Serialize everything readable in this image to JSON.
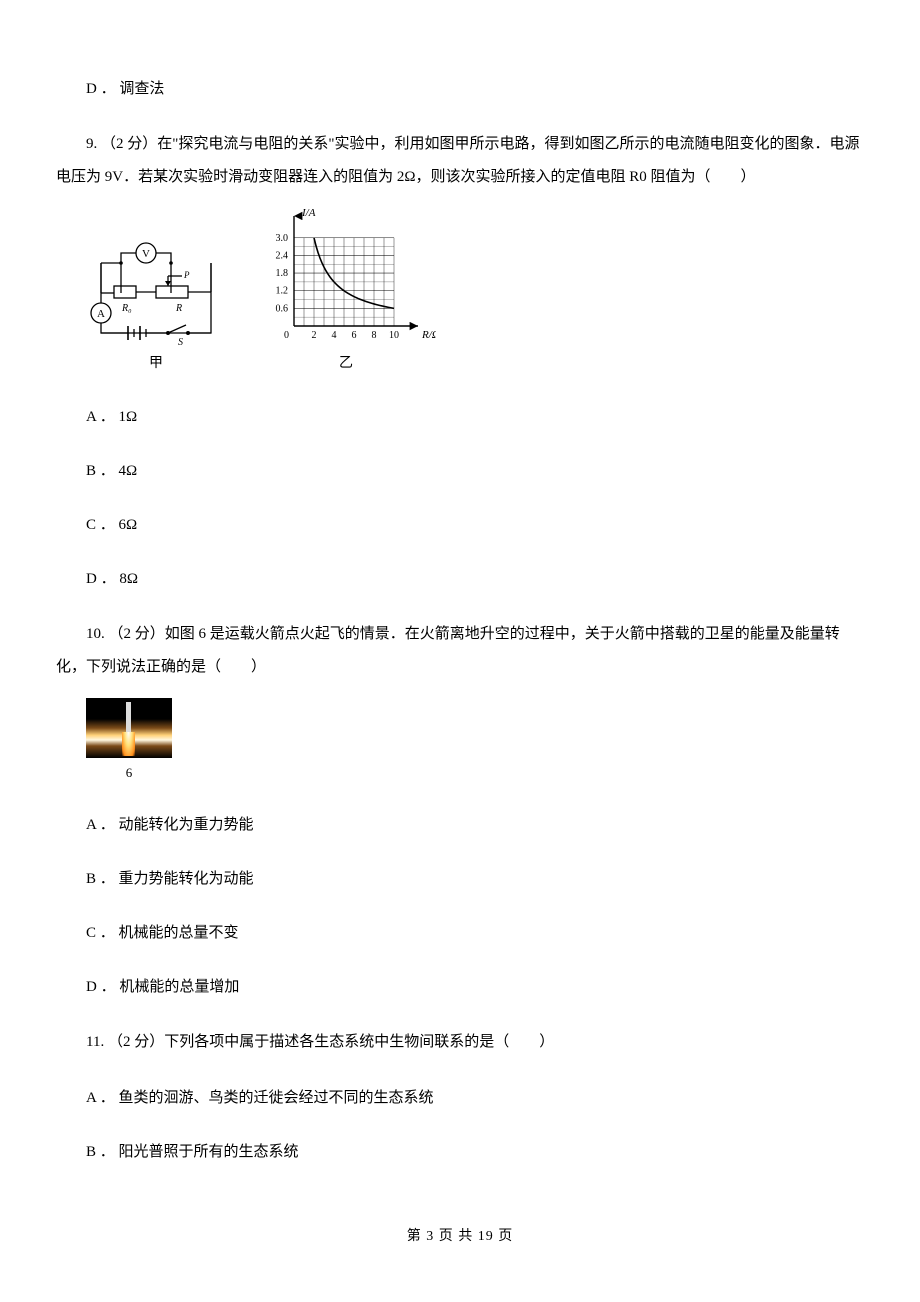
{
  "q8": {
    "option_d": "D ． 调查法"
  },
  "q9": {
    "stem": "9. （2 分）在\"探究电流与电阻的关系\"实验中，利用如图甲所示电路，得到如图乙所示的电流随电阻变化的图象．电源电压为 9V．若某次实验时滑动变阻器连入的阻值为 2Ω，则该次实验所接入的定值电阻 R0 阻值为（　　）",
    "circuit_caption": "甲",
    "circuit_labels": {
      "V": "V",
      "A": "A",
      "S": "S",
      "R0": "R₀",
      "R": "R",
      "P": "P"
    },
    "graph_caption": "乙",
    "graph_axes": {
      "ylabel": "I/A",
      "xlabel": "R/Ω"
    },
    "options": {
      "A": "A ． 1Ω",
      "B": "B ． 4Ω",
      "C": "C ． 6Ω",
      "D": "D ． 8Ω"
    }
  },
  "q10": {
    "stem": "10. （2 分）如图 6 是运载火箭点火起飞的情景．在火箭离地升空的过程中，关于火箭中搭载的卫星的能量及能量转化，下列说法正确的是（　　）",
    "fig_caption": "6",
    "options": {
      "A": "A ． 动能转化为重力势能",
      "B": "B ． 重力势能转化为动能",
      "C": "C ． 机械能的总量不变",
      "D": "D ． 机械能的总量增加"
    }
  },
  "q11": {
    "stem": "11. （2 分）下列各项中属于描述各生态系统中生物间联系的是（　　）",
    "options": {
      "A": "A ． 鱼类的洄游、鸟类的迁徙会经过不同的生态系统",
      "B": "B ． 阳光普照于所有的生态系统"
    }
  },
  "footer": "第 3 页 共 19 页",
  "chart_data": {
    "type": "line",
    "title": "",
    "xlabel": "R/Ω",
    "ylabel": "I/A",
    "xlim": [
      0,
      11
    ],
    "ylim": [
      0,
      3.4
    ],
    "x_ticks": [
      2,
      4,
      6,
      8,
      10
    ],
    "y_ticks": [
      0.6,
      1.2,
      1.8,
      2.4,
      3.0
    ],
    "x": [
      2,
      4,
      6,
      8,
      10
    ],
    "values": [
      3.0,
      1.5,
      1.0,
      0.75,
      0.6
    ]
  }
}
